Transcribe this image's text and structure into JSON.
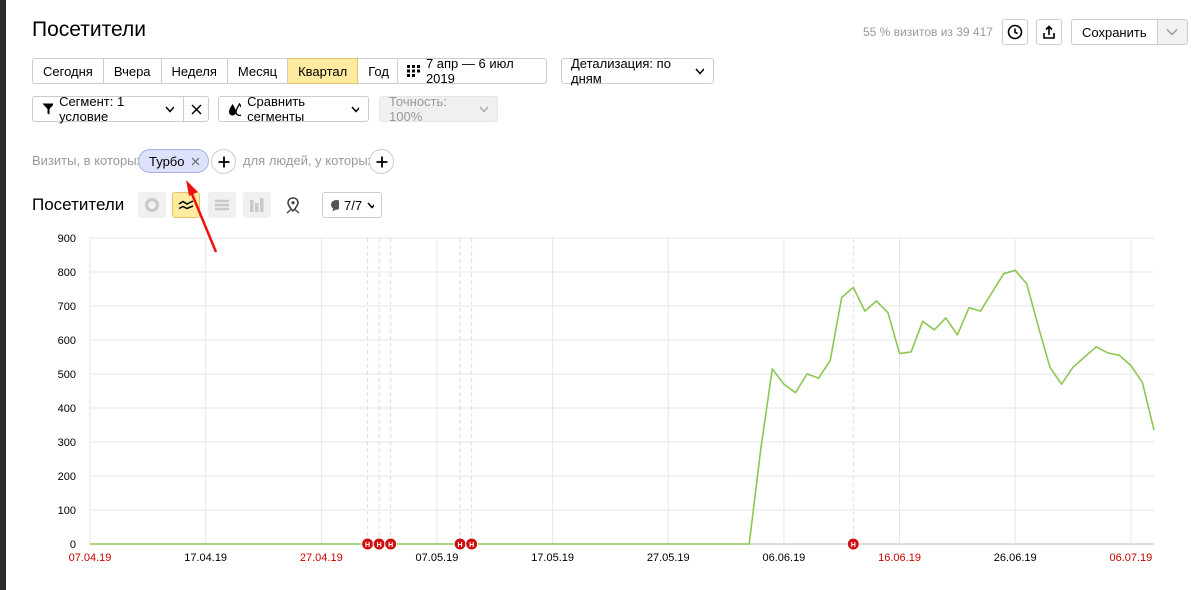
{
  "header": {
    "title": "Посетители",
    "visits_note": "55 % визитов из 39 417",
    "save_label": "Сохранить"
  },
  "periods": [
    {
      "label": "Сегодня",
      "active": false
    },
    {
      "label": "Вчера",
      "active": false
    },
    {
      "label": "Неделя",
      "active": false
    },
    {
      "label": "Месяц",
      "active": false
    },
    {
      "label": "Квартал",
      "active": true
    },
    {
      "label": "Год",
      "active": false
    }
  ],
  "toolbar": {
    "date_range": "7 апр — 6 июл 2019",
    "detail": "Детализация: по дням",
    "segment": "Сегмент: 1 условие",
    "compare": "Сравнить сегменты",
    "accuracy": "Точность: 100%"
  },
  "filter": {
    "prefix": "Визиты, в которых",
    "chip": "Турбо",
    "people": "для людей, у которых"
  },
  "chart_section": {
    "title": "Посетители",
    "series_count": "7/7"
  },
  "colors": {
    "line": "#8dc653",
    "weekend": "#cc0000",
    "annotation": "#cc1111",
    "accent": "#ffeba0"
  },
  "icons": [
    "history-icon",
    "export-icon",
    "calendar-icon",
    "funnel-icon",
    "close-icon",
    "drops-icon",
    "pie-icon",
    "line-chart-icon",
    "area-chart-icon",
    "bar-chart-icon",
    "map-pin-icon",
    "comment-icon",
    "plus-icon"
  ],
  "chart_data": {
    "type": "line",
    "title": "",
    "xlabel": "",
    "ylabel": "",
    "ylim": [
      0,
      900
    ],
    "yticks": [
      "0",
      "100",
      "200",
      "300",
      "400",
      "500",
      "600",
      "700",
      "800",
      "900"
    ],
    "xticks": [
      {
        "label": "07.04.19",
        "day": 0,
        "weekend": true
      },
      {
        "label": "17.04.19",
        "day": 10,
        "weekend": false
      },
      {
        "label": "27.04.19",
        "day": 20,
        "weekend": true
      },
      {
        "label": "07.05.19",
        "day": 30,
        "weekend": false
      },
      {
        "label": "17.05.19",
        "day": 40,
        "weekend": false
      },
      {
        "label": "27.05.19",
        "day": 50,
        "weekend": false
      },
      {
        "label": "06.06.19",
        "day": 60,
        "weekend": false
      },
      {
        "label": "16.06.19",
        "day": 70,
        "weekend": true
      },
      {
        "label": "26.06.19",
        "day": 80,
        "weekend": false
      },
      {
        "label": "06.07.19",
        "day": 90,
        "weekend": true
      }
    ],
    "annotation_days": [
      24,
      25,
      26,
      32,
      33,
      66
    ],
    "annotation_label": "H",
    "series": [
      {
        "values": [
          0,
          0,
          0,
          0,
          0,
          0,
          0,
          0,
          0,
          0,
          0,
          0,
          0,
          0,
          0,
          0,
          0,
          0,
          0,
          0,
          0,
          0,
          0,
          0,
          0,
          0,
          0,
          0,
          0,
          0,
          0,
          0,
          0,
          0,
          0,
          0,
          0,
          0,
          0,
          0,
          0,
          0,
          0,
          0,
          0,
          0,
          0,
          0,
          0,
          0,
          0,
          0,
          0,
          0,
          0,
          0,
          0,
          0,
          280,
          515,
          470,
          445,
          500,
          488,
          540,
          725,
          755,
          685,
          715,
          680,
          560,
          565,
          655,
          630,
          665,
          615,
          695,
          685,
          740,
          795,
          805,
          765,
          640,
          520,
          470,
          520,
          550,
          580,
          562,
          555,
          525,
          475,
          335
        ]
      }
    ]
  }
}
